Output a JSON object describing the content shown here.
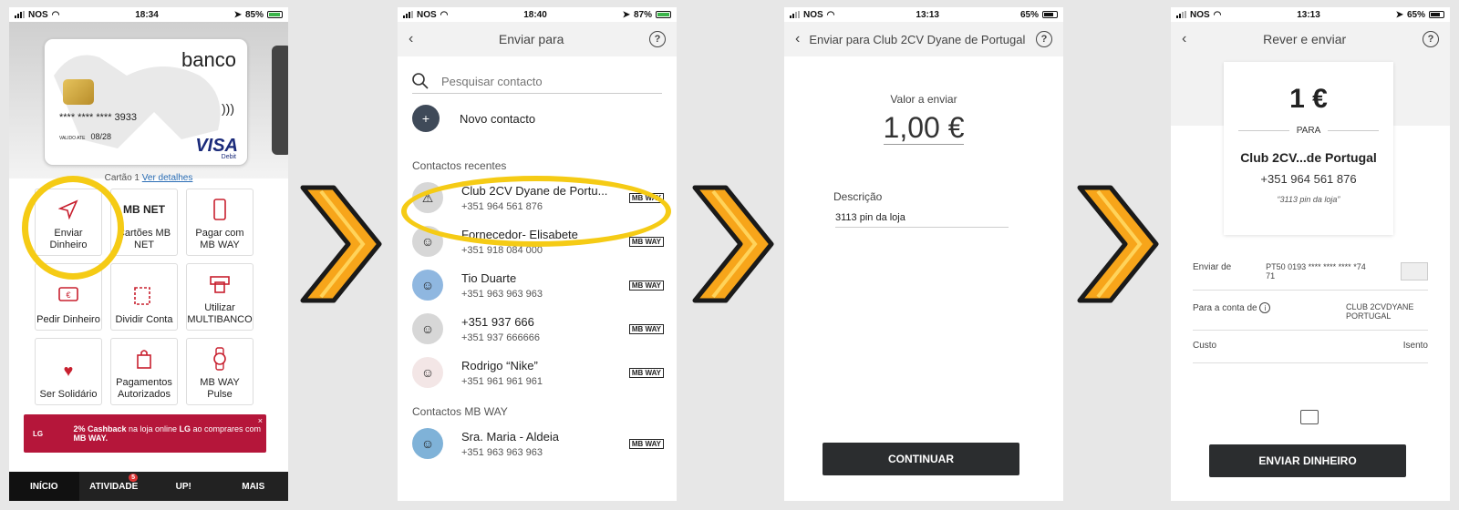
{
  "screens": {
    "home": {
      "status": {
        "carrier": "NOS",
        "time": "18:34",
        "battery": "85%"
      },
      "card": {
        "bank": "banco",
        "number": "**** **** **** 3933",
        "valid_label": "VALIDO ATE",
        "valid": "08/28",
        "brand": "VISA",
        "brand_sub": "Debit"
      },
      "card_label": "Cartão 1",
      "card_link": "Ver detalhes",
      "tiles": [
        {
          "label": "Enviar Dinheiro"
        },
        {
          "label": "Cartões MB NET",
          "badge": "MB NET"
        },
        {
          "label": "Pagar com MB WAY"
        },
        {
          "label": "Pedir Dinheiro"
        },
        {
          "label": "Dividir Conta"
        },
        {
          "label": "Utilizar MULTIBANCO"
        },
        {
          "label": "Ser Solidário"
        },
        {
          "label": "Pagamentos Autorizados"
        },
        {
          "label": "MB WAY Pulse"
        }
      ],
      "promo": {
        "logo": "LG",
        "bold1": "2% Cashback",
        "text1": " na loja online ",
        "bold2": "LG",
        "text2": " ao comprares com ",
        "bold3": "MB WAY.",
        "close": "×"
      },
      "tabs": [
        {
          "label": "INÍCIO"
        },
        {
          "label": "ATIVIDADE",
          "badge": "5"
        },
        {
          "label": "UP!"
        },
        {
          "label": "MAIS"
        }
      ]
    },
    "send_to": {
      "status": {
        "carrier": "NOS",
        "time": "18:40",
        "battery": "87%"
      },
      "title": "Enviar para",
      "help": "?",
      "search_placeholder": "Pesquisar contacto",
      "new_contact": "Novo contacto",
      "recent_header": "Contactos recentes",
      "mbway_badge": "MB WAY",
      "recent": [
        {
          "name": "Club 2CV Dyane de Portu...",
          "phone": "+351 964 561 876"
        },
        {
          "name": "Fornecedor- Elisabete",
          "phone": "+351 918 084 000"
        },
        {
          "name": "Tio Duarte",
          "phone": "+351 963 963 963"
        },
        {
          "name": "+351 937 666",
          "phone": "+351 937 666666"
        },
        {
          "name": "Rodrigo  “Nike”",
          "phone": "+351 961 961 961"
        }
      ],
      "mbway_header": "Contactos MB WAY",
      "mbway_contacts": [
        {
          "name": "Sra. Maria - Aldeia",
          "phone": "+351 963 963 963"
        }
      ]
    },
    "amount": {
      "status": {
        "carrier": "NOS",
        "time": "13:13",
        "battery": "65%"
      },
      "title": "Enviar para Club 2CV Dyane de Portugal",
      "help": "?",
      "value_label": "Valor a enviar",
      "value": "1,00 €",
      "desc_label": "Descrição",
      "desc": "3113 pin da loja",
      "button": "CONTINUAR"
    },
    "review": {
      "status": {
        "carrier": "NOS",
        "time": "13:13",
        "battery": "65%"
      },
      "title": "Rever e enviar",
      "help": "?",
      "amount": "1 €",
      "para": "PARA",
      "recipient": "Club 2CV...de Portugal",
      "phone": "+351 964 561 876",
      "note": "“3113 pin da loja”",
      "from_label": "Enviar de",
      "from_value": "PT50 0193 **** **** **** *74 71",
      "to_label": "Para a conta de",
      "to_value": "CLUB 2CVDYANE PORTUGAL",
      "cost_label": "Custo",
      "cost_value": "Isento",
      "button": "ENVIAR DINHEIRO"
    }
  },
  "colors": {
    "highlight": "#f5cb15",
    "arrow": "#f7a51a",
    "dark": "#2b2d2f",
    "promo": "#b5163a"
  }
}
